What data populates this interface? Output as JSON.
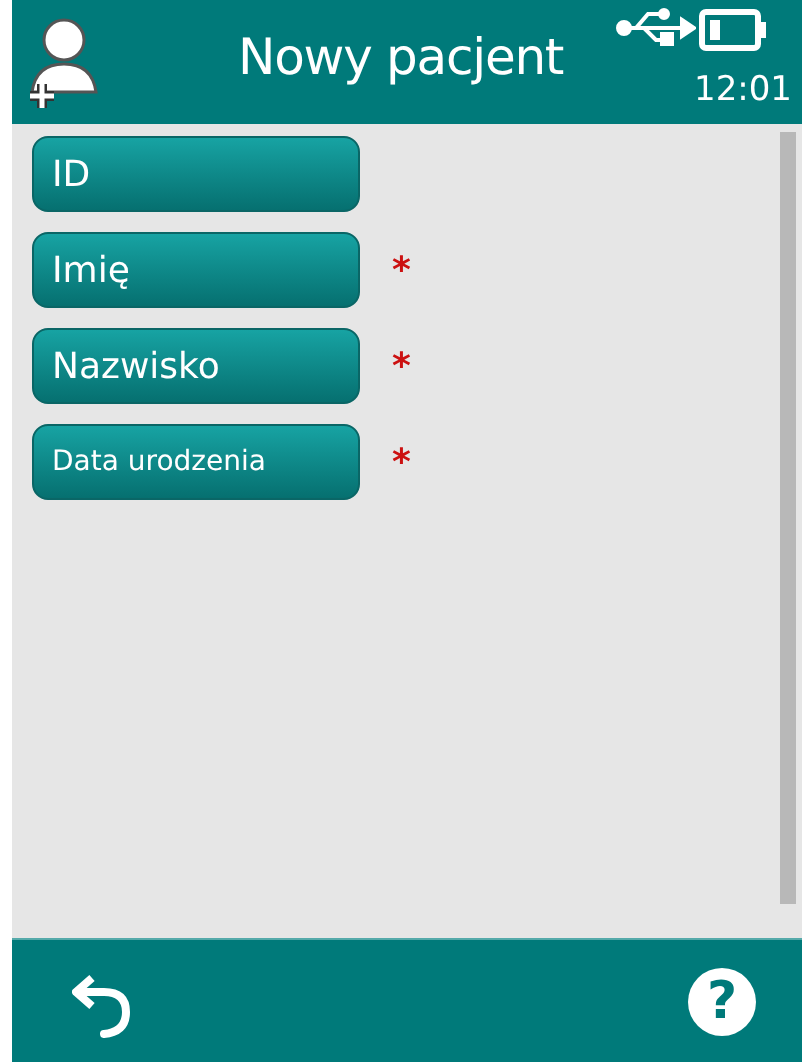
{
  "header": {
    "title": "Nowy pacjent",
    "time": "12:01"
  },
  "fields": [
    {
      "label": "ID"
    },
    {
      "label": "Imię",
      "required_mark": "*"
    },
    {
      "label": "Nazwisko",
      "required_mark": "*"
    },
    {
      "label": "Data urodzenia",
      "required_mark": "*",
      "small": true
    }
  ],
  "footer": {
    "help": "?"
  }
}
